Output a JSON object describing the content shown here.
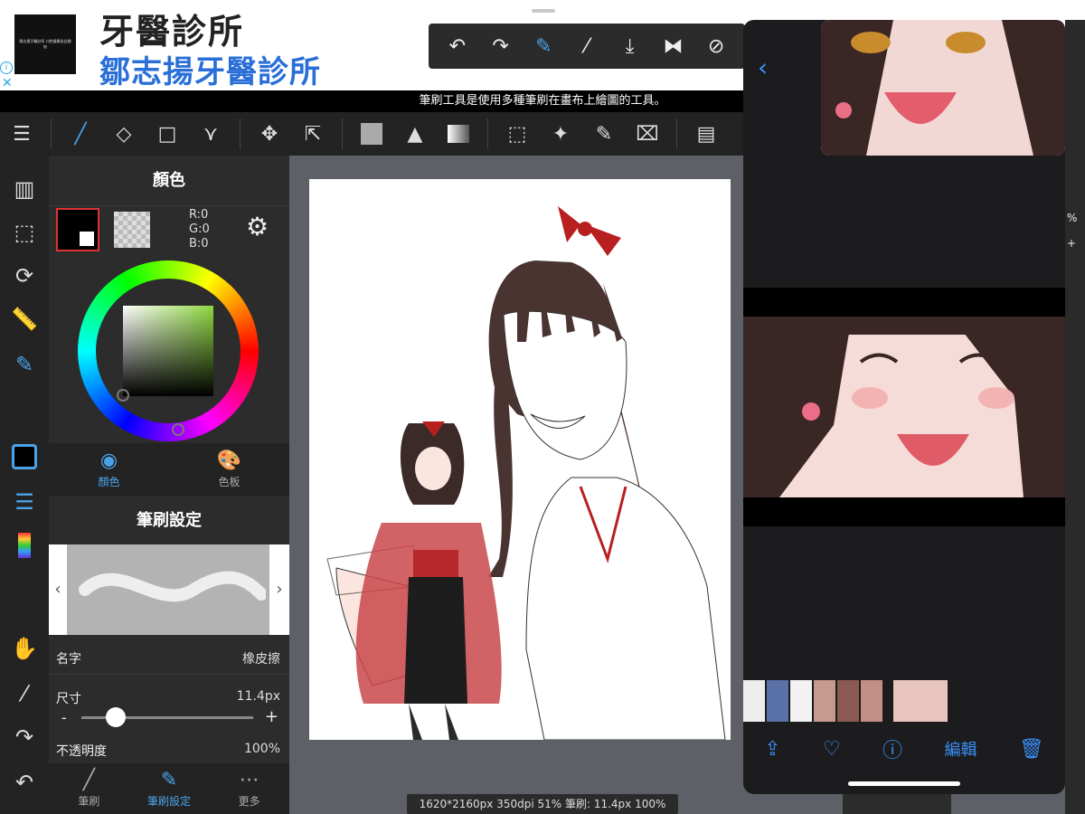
{
  "ad": {
    "title": "牙醫診所",
    "subtitle": "鄒志揚牙醫診所",
    "logo_text": "鄒志揚牙醫診所 口腔健康從此開始",
    "info_icon": "info-icon",
    "close_icon": "close-icon"
  },
  "floating_toolbar": {
    "icons": [
      "undo-icon",
      "redo-icon",
      "brush-transform-icon",
      "eyedropper-icon",
      "save-icon",
      "flip-icon",
      "rotate-off-icon"
    ]
  },
  "hint": "筆刷工具是使用多種筆刷在畫布上繪圖的工具。",
  "main_toolbar": {
    "icons": [
      "menu-icon",
      "brush-icon",
      "eraser-icon",
      "shape-icon",
      "vector-icon",
      "move-icon",
      "transform-icon",
      "fill-color-icon",
      "bucket-icon",
      "gradient-icon",
      "select-rect-icon",
      "magic-wand-icon",
      "select-pen-icon",
      "select-eraser-icon",
      "panel-layout-icon"
    ]
  },
  "left_strip": {
    "icons": [
      "layers-icon",
      "selection-icon",
      "rotate-icon",
      "ruler-icon",
      "brush-setting-icon",
      "color-swatch-icon",
      "layer-list-icon",
      "palette-strip-icon",
      "hand-icon",
      "eyedropper-icon",
      "redo-icon",
      "undo-icon"
    ]
  },
  "color_panel": {
    "title": "顏色",
    "rgb": {
      "r": "R:0",
      "g": "G:0",
      "b": "B:0"
    },
    "fg_color": "#000000",
    "tabs": [
      {
        "label": "顏色",
        "active": true
      },
      {
        "label": "色板",
        "active": false
      }
    ]
  },
  "brush_panel": {
    "title": "筆刷設定",
    "name_label": "名字",
    "name_value": "橡皮擦",
    "size_label": "尺寸",
    "size_value": "11.4px",
    "size_minus": "-",
    "size_plus": "+",
    "size_fraction": 0.2,
    "opacity_label": "不透明度",
    "opacity_value": "100%",
    "tabs": [
      {
        "label": "筆刷",
        "active": false
      },
      {
        "label": "筆刷設定",
        "active": true
      },
      {
        "label": "更多",
        "active": false
      }
    ]
  },
  "status_bar": "1620*2160px 350dpi 51% 筆刷: 11.4px 100%",
  "photos": {
    "back_icon": "chevron-left-icon",
    "bottom_actions": [
      {
        "name": "share-icon",
        "label": ""
      },
      {
        "name": "heart-icon",
        "label": ""
      },
      {
        "name": "info-icon",
        "label": ""
      },
      {
        "name": "edit",
        "label": "編輯"
      },
      {
        "name": "trash-icon",
        "label": ""
      }
    ]
  },
  "right_edge": {
    "percent": "%",
    "plus": "+"
  },
  "colors": {
    "accent": "#3a8ef6",
    "brush_accent": "#4aa3e8",
    "red_border": "#dd3333"
  }
}
